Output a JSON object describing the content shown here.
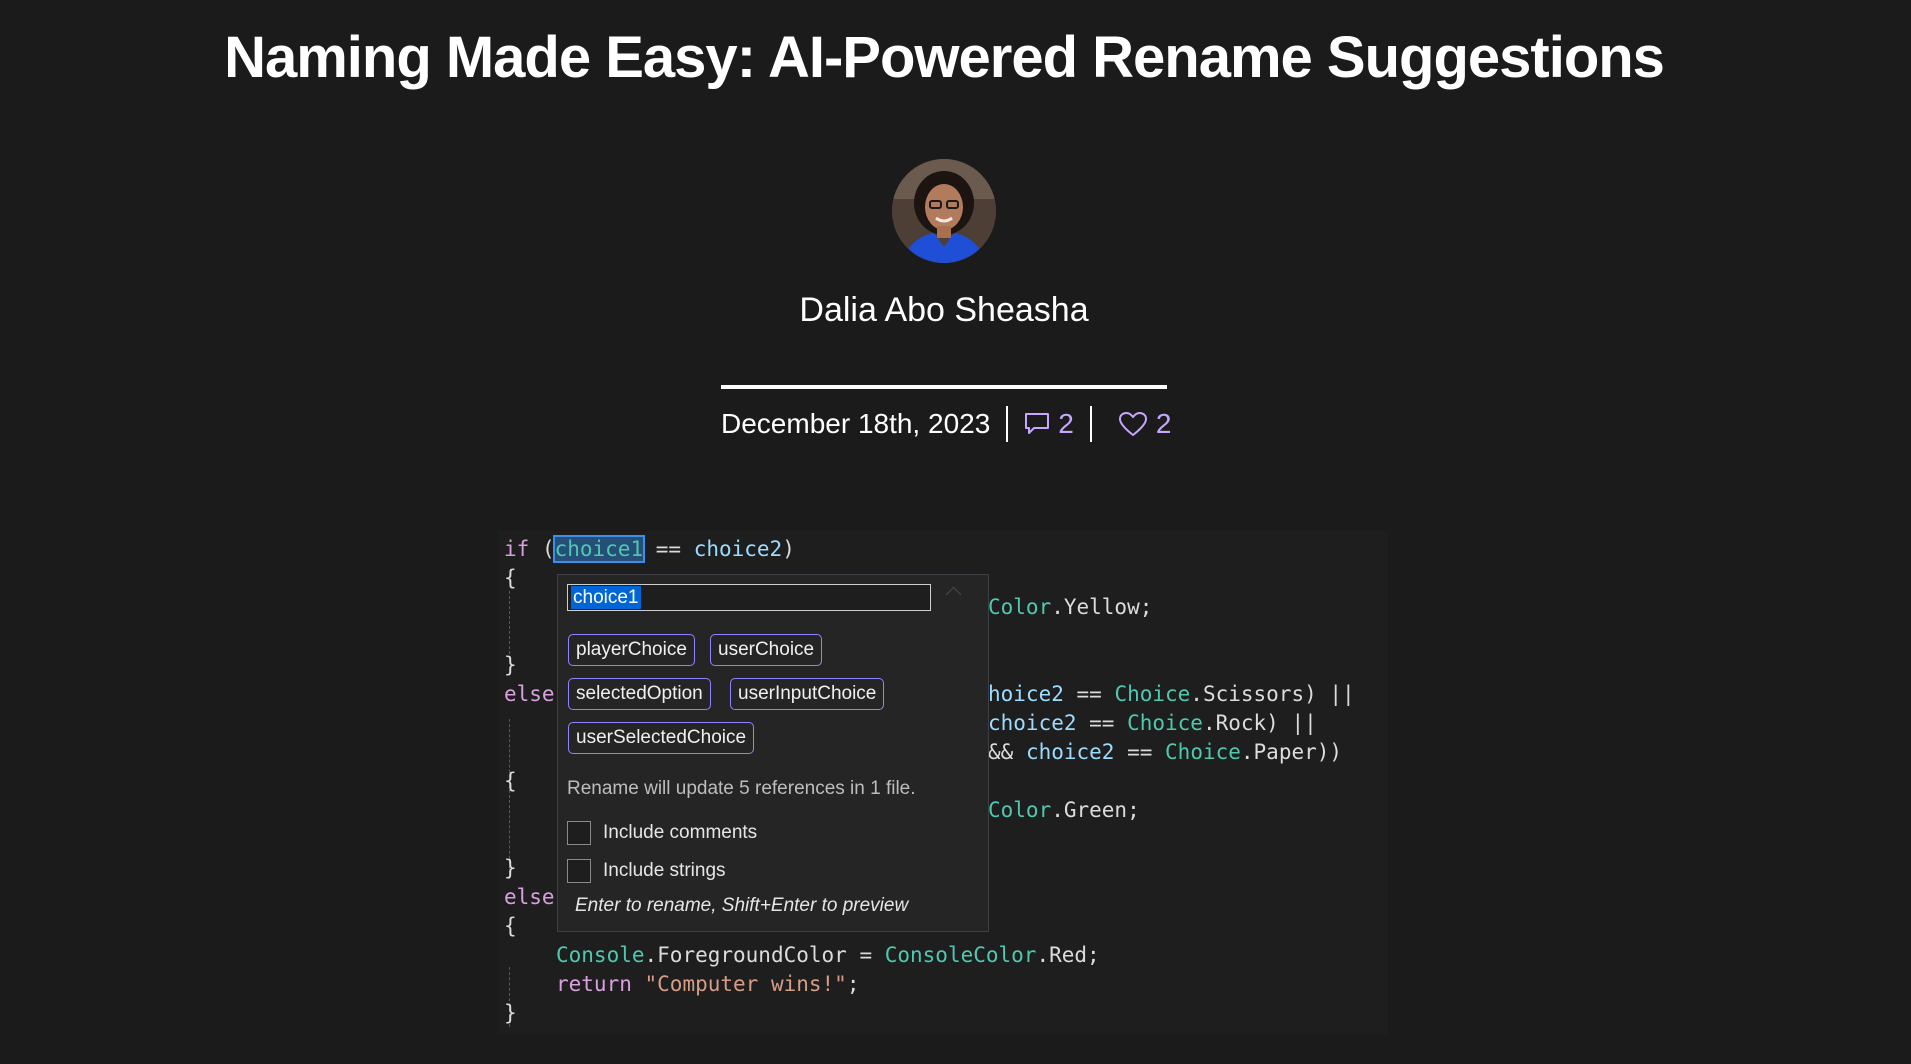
{
  "article": {
    "title": "Naming Made Easy: AI-Powered Rename Suggestions",
    "author": "Dalia Abo Sheasha",
    "date": "December 18th, 2023",
    "comments_count": "2",
    "likes_count": "2"
  },
  "icons": {
    "avatar": "author-avatar-photo",
    "comments": "comment-bubble-icon",
    "likes": "heart-icon"
  },
  "colors": {
    "page_background": "#1b1b1b",
    "accent": "#c7a6ff",
    "chip_border": "#8f85ff",
    "editor_background": "#1e1e1e"
  },
  "editor": {
    "lines": {
      "l1": {
        "kw": "if",
        "open": " (",
        "sym": "choice1",
        "op": " == ",
        "id2": "choice2",
        "close": ")"
      },
      "l2": {
        "text": "{"
      },
      "l3": {
        "ty": "Color",
        "rest": ".Yellow;"
      },
      "l4": {
        "text": "}"
      },
      "l5": {
        "kw": "else",
        "frag": "hoice2",
        "op": " == ",
        "ty": "Choice",
        "rest": ".Scissors) ||"
      },
      "l6": {
        "id": "choice2",
        "op": " == ",
        "ty": "Choice",
        "rest": ".Rock) ||"
      },
      "l7": {
        "pre": "&& ",
        "id": "choice2",
        "op": " == ",
        "ty": "Choice",
        "rest": ".Paper))"
      },
      "l8": {
        "text": "{"
      },
      "l9": {
        "ty": "Color",
        "rest": ".Green;"
      },
      "l10": {
        "text": "}"
      },
      "l11": {
        "kw": "else"
      },
      "l12": {
        "text": "{"
      },
      "l13": {
        "ty1": "Console",
        "mid": ".ForegroundColor = ",
        "ty2": "ConsoleColor",
        "rest": ".Red;"
      },
      "l14": {
        "kw": "return",
        "str": "\"Computer wins!\"",
        "rest": ";"
      },
      "l15": {
        "text": "}"
      }
    }
  },
  "rename_popup": {
    "input_value": "choice1",
    "suggestions": [
      "playerChoice",
      "userChoice",
      "selectedOption",
      "userInputChoice",
      "userSelectedChoice"
    ],
    "info": "Rename will update 5 references in 1 file.",
    "include_comments_label": "Include comments",
    "include_strings_label": "Include strings",
    "hint": "Enter to rename, Shift+Enter to preview"
  }
}
